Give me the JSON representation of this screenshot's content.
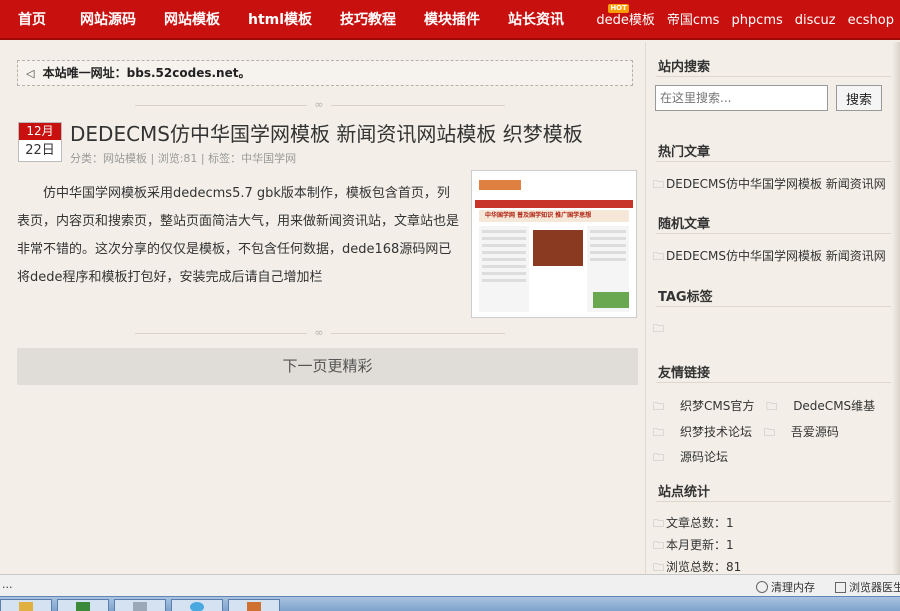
{
  "nav": {
    "main": [
      "首页",
      "网站源码",
      "网站模板",
      "html模板",
      "技巧教程",
      "模块插件",
      "站长资讯"
    ],
    "right": [
      "dede模板",
      "帝国cms",
      "phpcms",
      "discuz",
      "ecshop"
    ],
    "hot_badge": "HOT"
  },
  "notice": {
    "prefix": "本站唯一网址：",
    "url": "bbs.52codes.net。"
  },
  "post": {
    "month": "12月",
    "day": "22日",
    "title": "DEDECMS仿中华国学网模板 新闻资讯网站模板 织梦模板",
    "meta_category_label": "分类：",
    "meta_category": "网站模板",
    "meta_views": "浏览:81",
    "meta_tag_label": "标签：",
    "meta_tag": "中华国学网",
    "body": "仿中华国学网模板采用dedecms5.7 gbk版本制作，模板包含首页，列表页，内容页和搜索页，整站页面简洁大气，用来做新闻资讯站，文章站也是非常不错的。这次分享的仅仅是模板，不包含任何数据，dede168源码网已将dede程序和模板打包好，安装完成后请自己增加栏",
    "thumb_banner": "中华国学网 普及国学知识 推广国学思想"
  },
  "next_page": "下一页更精彩",
  "sidebar": {
    "search_title": "站内搜索",
    "search_placeholder": "在这里搜索...",
    "search_button": "搜索",
    "hot_title": "热门文章",
    "hot_item": "DEDECMS仿中华国学网模板 新闻资讯网",
    "random_title": "随机文章",
    "random_item": "DEDECMS仿中华国学网模板 新闻资讯网",
    "tag_title": "TAG标签",
    "links_title": "友情链接",
    "links": [
      "织梦CMS官方",
      "DedeCMS维基",
      "织梦技术论坛",
      "吾爱源码",
      "源码论坛"
    ],
    "stats_title": "站点统计",
    "stats": [
      "文章总数：1",
      "本月更新：1",
      "浏览总数：81"
    ]
  },
  "statusbar": {
    "dots": "...",
    "clear_memory": "清理内存",
    "browser_mode": "浏览器医生"
  }
}
